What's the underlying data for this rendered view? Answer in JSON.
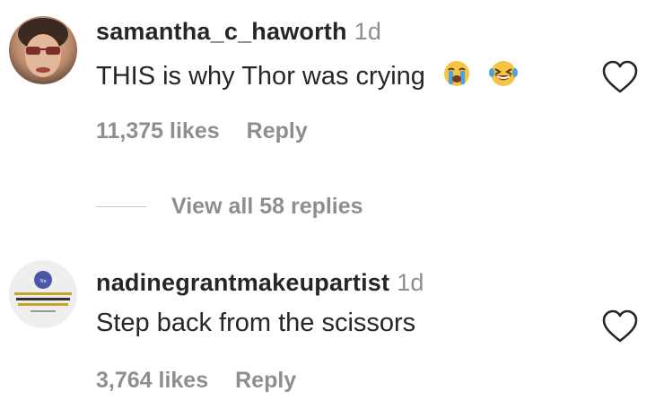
{
  "comments": [
    {
      "username": "samantha_c_haworth",
      "time": "1d",
      "text": "THIS is why Thor was crying",
      "emojis": [
        "crying-face-emoji",
        "laughing-tears-emoji"
      ],
      "likes": "11,375 likes",
      "reply_label": "Reply",
      "avatar": "user-avatar-photo",
      "like_icon": "heart-outline-icon"
    },
    {
      "username": "nadinegrantmakeupartist",
      "time": "1d",
      "text": "Step back from the scissors",
      "likes": "3,764 likes",
      "reply_label": "Reply",
      "avatar": "makeup-artist-logo-avatar",
      "like_icon": "heart-outline-icon"
    }
  ],
  "view_replies": {
    "label": "View all 58 replies"
  },
  "colors": {
    "primary_text": "#262626",
    "secondary_text": "#8e8e8e",
    "divider": "#c7c7c7"
  }
}
